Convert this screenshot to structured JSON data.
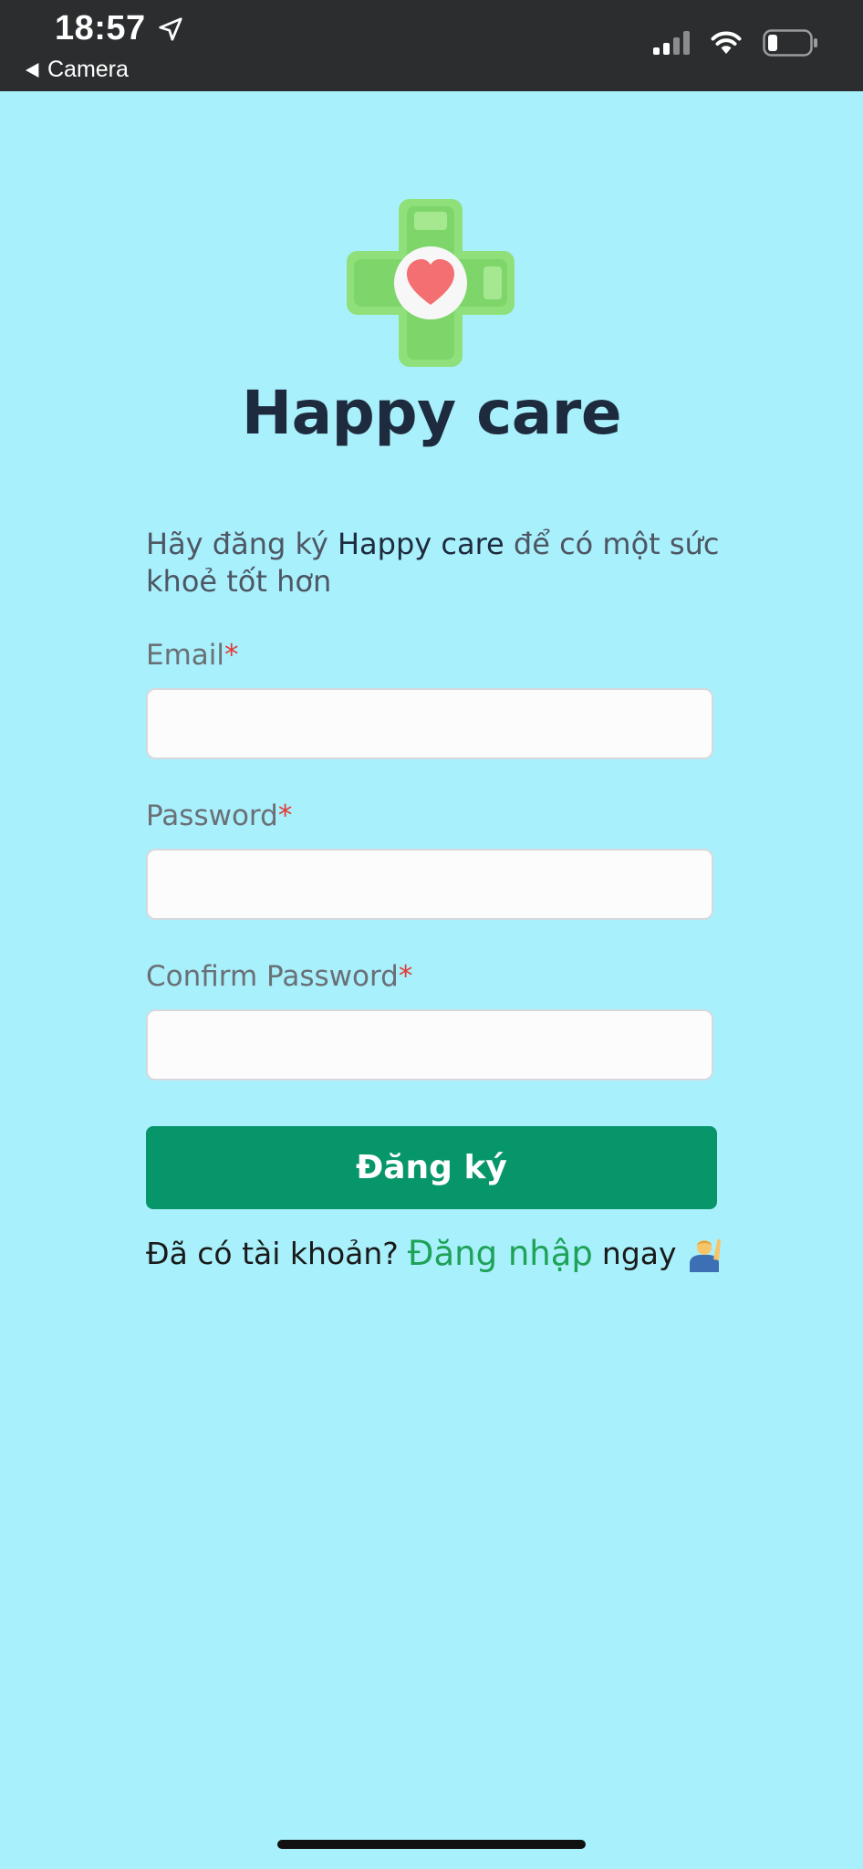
{
  "status_bar": {
    "time": "18:57",
    "back_label": "Camera"
  },
  "app": {
    "title": "Happy care"
  },
  "intro": {
    "prefix": "Hãy đăng ký ",
    "brand": "Happy care",
    "suffix": " để có một sức khoẻ tốt hơn"
  },
  "form": {
    "email_label": "Email",
    "password_label": "Password",
    "confirm_label": "Confirm Password",
    "required_mark": "*",
    "email_value": "",
    "password_value": "",
    "confirm_value": "",
    "submit_label": "Đăng ký"
  },
  "footer": {
    "prefix": "Đã có tài khoản?",
    "link_label": "Đăng nhập",
    "suffix": "ngay"
  },
  "colors": {
    "background": "#a8f0fb",
    "primary_button": "#07956a",
    "link": "#1ea257",
    "required": "#e53935",
    "title": "#1e2a3d"
  },
  "icons": [
    "location-arrow-icon",
    "back-triangle-icon",
    "cellular-signal-icon",
    "wifi-icon",
    "battery-icon",
    "medical-cross-heart-logo",
    "person-raising-hand-emoji"
  ]
}
